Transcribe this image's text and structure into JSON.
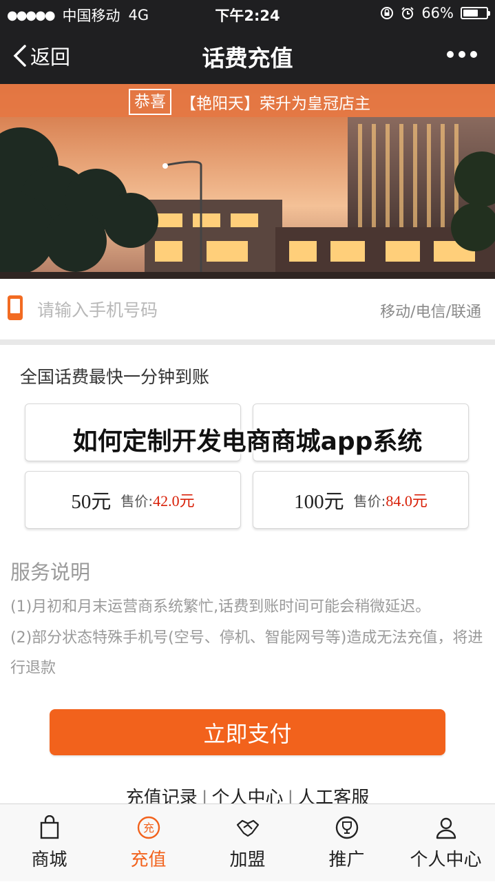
{
  "status_bar": {
    "signal": "●●●●●",
    "carrier": "中国移动",
    "network": "4G",
    "time": "下午2:24",
    "battery": "66%",
    "battery_level": 0.66
  },
  "nav": {
    "back_label": "返回",
    "title": "话费充值"
  },
  "banner": {
    "notice_tag": "恭喜",
    "notice_text": "【艳阳天】荣升为皇冠店主"
  },
  "phone": {
    "placeholder": "请输入手机号码",
    "value": "",
    "carriers": "移动/电信/联通"
  },
  "recharge": {
    "subtitle": "全国话费最快一分钟到账",
    "price_prefix": "售价:",
    "options": [
      {
        "amount": "",
        "price": ""
      },
      {
        "amount": "",
        "price": ""
      },
      {
        "amount": "50元",
        "price": "42.0元"
      },
      {
        "amount": "100元",
        "price": "84.0元"
      }
    ]
  },
  "overlay_title": "如何定制开发电商商城app系统",
  "service": {
    "title": "服务说明",
    "line1": "(1)月初和月末运营商系统繁忙,话费到账时间可能会稍微延迟。",
    "line2": "(2)部分状态特殊手机号(空号、停机、智能网号等)造成无法充值，将进行退款"
  },
  "pay_button": "立即支付",
  "links": {
    "records": "充值记录",
    "center": "个人中心",
    "support": "人工客服",
    "separator": "|"
  },
  "tabs": [
    {
      "label": "商城",
      "icon": "shopping-bag-icon"
    },
    {
      "label": "充值",
      "icon": "recharge-icon"
    },
    {
      "label": "加盟",
      "icon": "handshake-icon"
    },
    {
      "label": "推广",
      "icon": "trophy-icon"
    },
    {
      "label": "个人中心",
      "icon": "user-icon"
    }
  ],
  "colors": {
    "accent": "#f2621c",
    "price": "#d81e06",
    "dark_bar": "#1f1f21"
  }
}
